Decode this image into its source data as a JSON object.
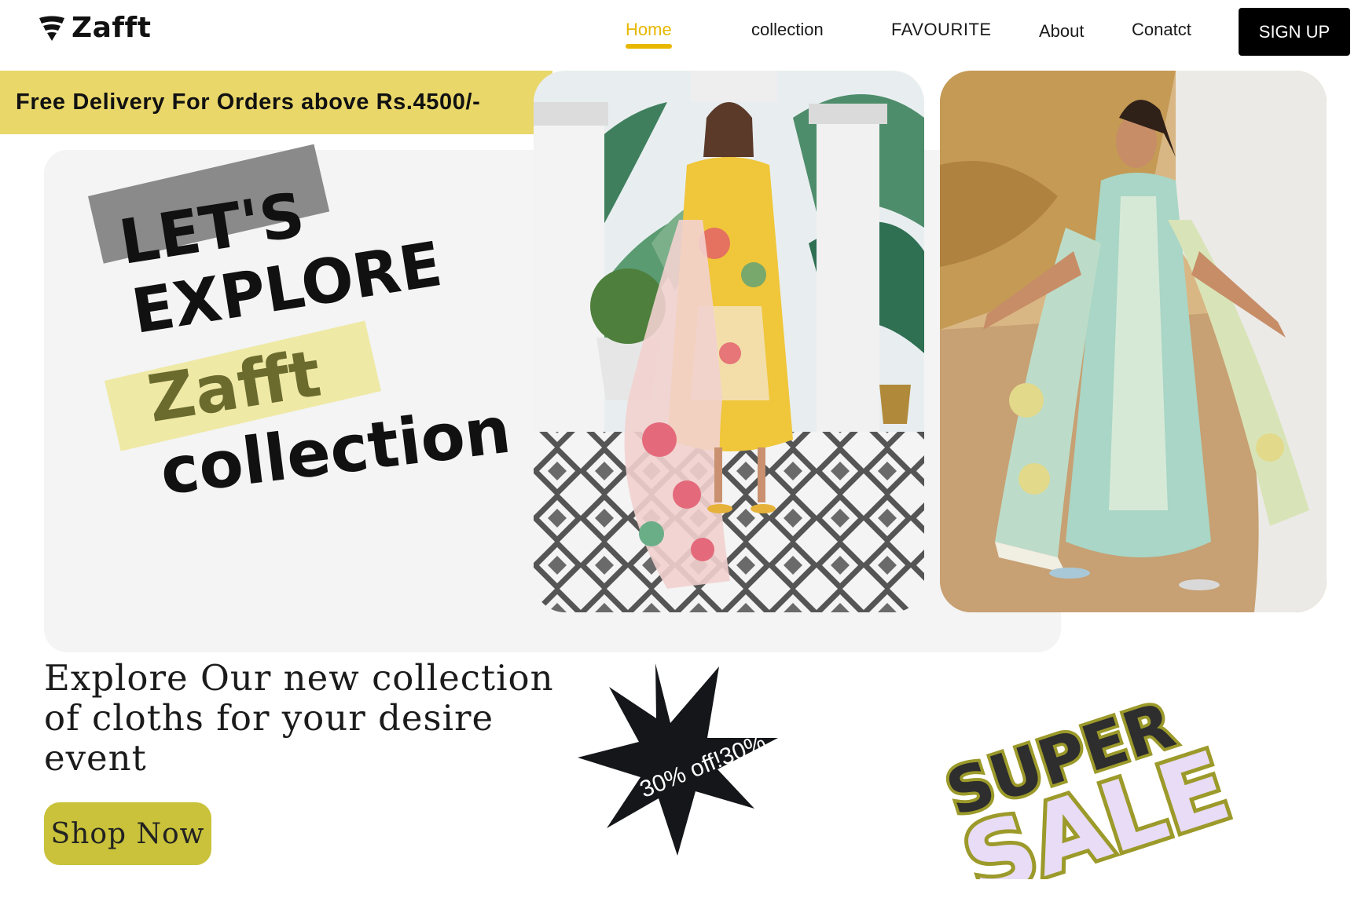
{
  "brand": {
    "name": "Zafft",
    "icon": "wifi-shield-logo-icon"
  },
  "nav": {
    "items": [
      {
        "label": "Home",
        "active": true
      },
      {
        "label": "collection",
        "active": false
      },
      {
        "label": "FAVOURITE",
        "active": false
      },
      {
        "label": "About",
        "active": false
      },
      {
        "label": "Conatct",
        "active": false
      }
    ],
    "signup_label": "SIGN UP"
  },
  "promo": {
    "text": "Free Delivery For Orders above Rs.4500/-"
  },
  "hero": {
    "line1": "LET'S",
    "line2": "EXPLORE",
    "line3": "Zafft",
    "line4": "collection"
  },
  "tagline": "Explore Our new collection of cloths for your desire event",
  "shop_button": "Shop Now",
  "badge": {
    "text": "30% off!30%"
  },
  "sale": {
    "word1": "SUPER",
    "word2": "SALE"
  },
  "colors": {
    "accent_yellow": "#e8b800",
    "promo_bg": "#e9d76a",
    "hero_bg": "#f3f4f3",
    "shop_button_bg": "#c9c23a",
    "sale_fill": "#e8dcf7",
    "sale_outline": "#9c9a2a"
  }
}
